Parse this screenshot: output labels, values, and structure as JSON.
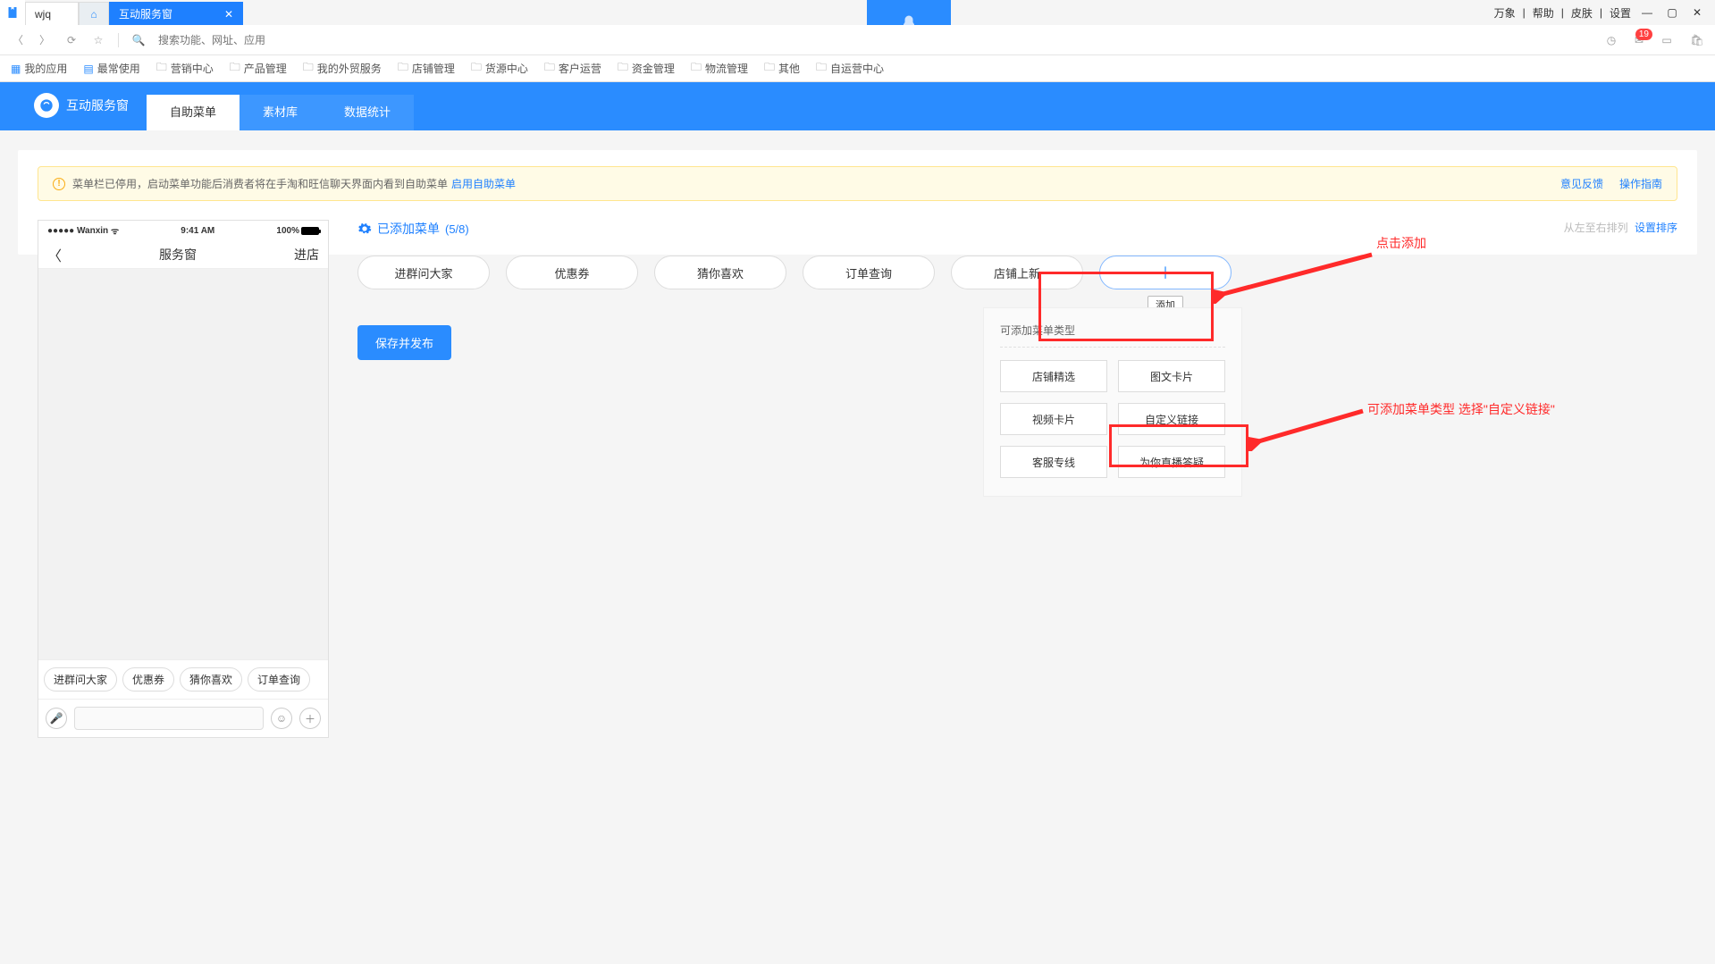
{
  "top_menu": {
    "wanxiang": "万象",
    "help": "帮助",
    "skin": "皮肤",
    "settings": "设置"
  },
  "tabs": {
    "profile": "wjq",
    "active": "互动服务窗"
  },
  "toolbar": {
    "search_placeholder": "搜索功能、网址、应用",
    "badge": "19"
  },
  "bookmarks": {
    "myapps": "我的应用",
    "freq": "最常使用",
    "items": [
      "营销中心",
      "产品管理",
      "我的外贸服务",
      "店铺管理",
      "货源中心",
      "客户运营",
      "资金管理",
      "物流管理",
      "其他",
      "自运营中心"
    ]
  },
  "app": {
    "title": "互动服务窗",
    "tabs": [
      "自助菜单",
      "素材库",
      "数据统计"
    ],
    "active_idx": 0
  },
  "notice": {
    "text": "菜单栏已停用，启动菜单功能后消费者将在手淘和旺信聊天界面内看到自助菜单",
    "link": "启用自助菜单",
    "feedback": "意见反馈",
    "guide": "操作指南"
  },
  "phone": {
    "carrier": "●●●●● Wanxin",
    "wifi": "✶",
    "time": "9:41 AM",
    "batt": "100%",
    "title": "服务窗",
    "enter": "进店",
    "chips": [
      "进群问大家",
      "优惠券",
      "猜你喜欢",
      "订单查询"
    ]
  },
  "editor": {
    "section": "已添加菜单",
    "count": "(5/8)",
    "sort_hint": "从左至右排列",
    "sort_link": "设置排序",
    "pills": [
      "进群问大家",
      "优惠券",
      "猜你喜欢",
      "订单查询",
      "店铺上新"
    ],
    "add_tooltip": "添加",
    "save_btn": "保存并发布"
  },
  "menu_types": {
    "title": "可添加菜单类型",
    "options": [
      "店铺精选",
      "图文卡片",
      "视频卡片",
      "自定义链接",
      "客服专线",
      "为你直播答疑"
    ]
  },
  "annotations": {
    "label1": "点击添加",
    "label2": "可添加菜单类型 选择\"自定义链接\""
  }
}
